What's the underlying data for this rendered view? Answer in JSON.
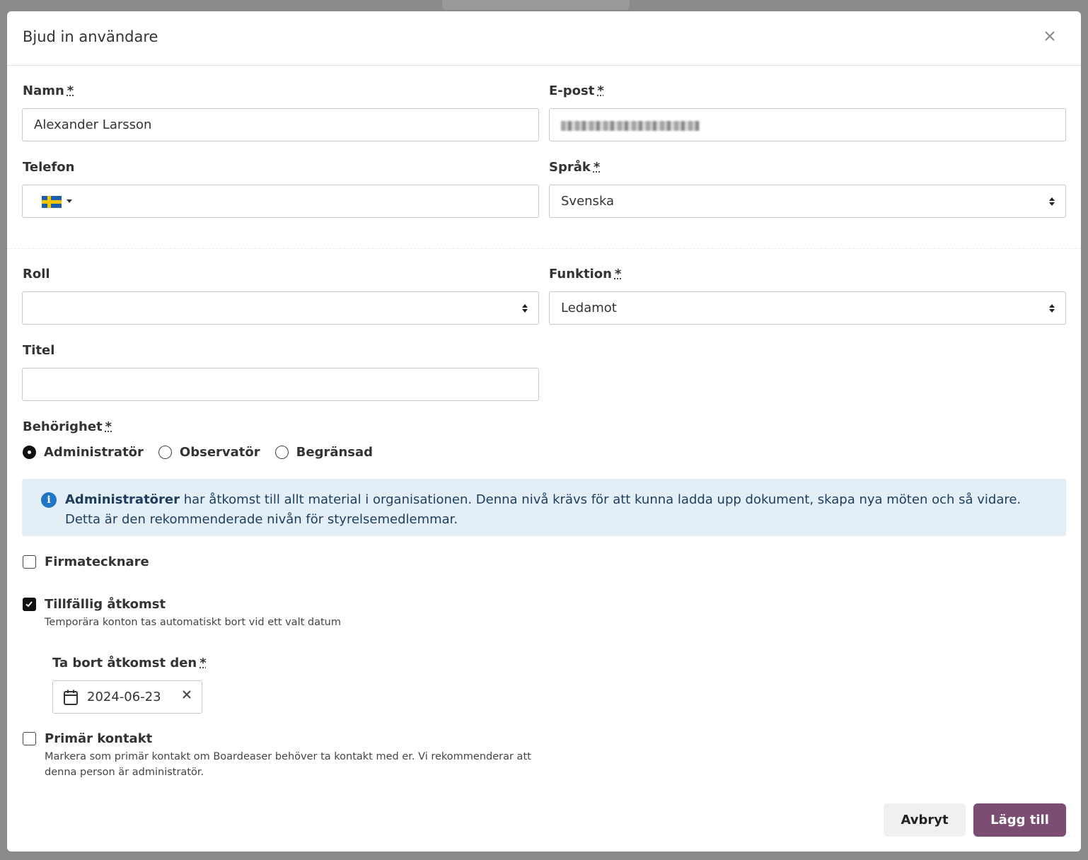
{
  "modal": {
    "title": "Bjud in användare",
    "close_label": "×"
  },
  "form": {
    "name": {
      "label": "Namn",
      "required_mark": "*",
      "value": "Alexander Larsson"
    },
    "email": {
      "label": "E-post",
      "required_mark": "*",
      "value": ""
    },
    "phone": {
      "label": "Telefon",
      "country_icon": "flag-sweden-icon",
      "value": ""
    },
    "language": {
      "label": "Språk",
      "required_mark": "*",
      "selected": "Svenska"
    },
    "role": {
      "label": "Roll",
      "selected": ""
    },
    "function": {
      "label": "Funktion",
      "required_mark": "*",
      "selected": "Ledamot"
    },
    "title": {
      "label": "Titel",
      "value": ""
    },
    "permission": {
      "label": "Behörighet",
      "required_mark": "*",
      "options": [
        {
          "label": "Administratör",
          "checked": true
        },
        {
          "label": "Observatör",
          "checked": false
        },
        {
          "label": "Begränsad",
          "checked": false
        }
      ]
    },
    "info": {
      "strong": "Administratörer",
      "text": " har åtkomst till allt material i organisationen. Denna nivå krävs för att kunna ladda upp dokument, skapa nya möten och så vidare. Detta är den rekommenderade nivån för styrelsemedlemmar."
    },
    "signatory": {
      "label": "Firmatecknare",
      "checked": false
    },
    "temporary": {
      "label": "Tillfällig åtkomst",
      "checked": true,
      "help": "Temporära konton tas automatiskt bort vid ett valt datum"
    },
    "remove_date": {
      "label": "Ta bort åtkomst den",
      "required_mark": "*",
      "value": "2024-06-23"
    },
    "primary_contact": {
      "label": "Primär kontakt",
      "checked": false,
      "help_line1": "Markera som primär kontakt om Boardeaser behöver ta kontakt med er. Vi rekommenderar att",
      "help_line2": "denna person är administratör."
    }
  },
  "actions": {
    "cancel_label": "Avbryt",
    "submit_label": "Lägg till"
  },
  "colors": {
    "accent": "#7b4d73",
    "info_bg": "#e3eef7",
    "info_icon": "#1f76c2"
  }
}
